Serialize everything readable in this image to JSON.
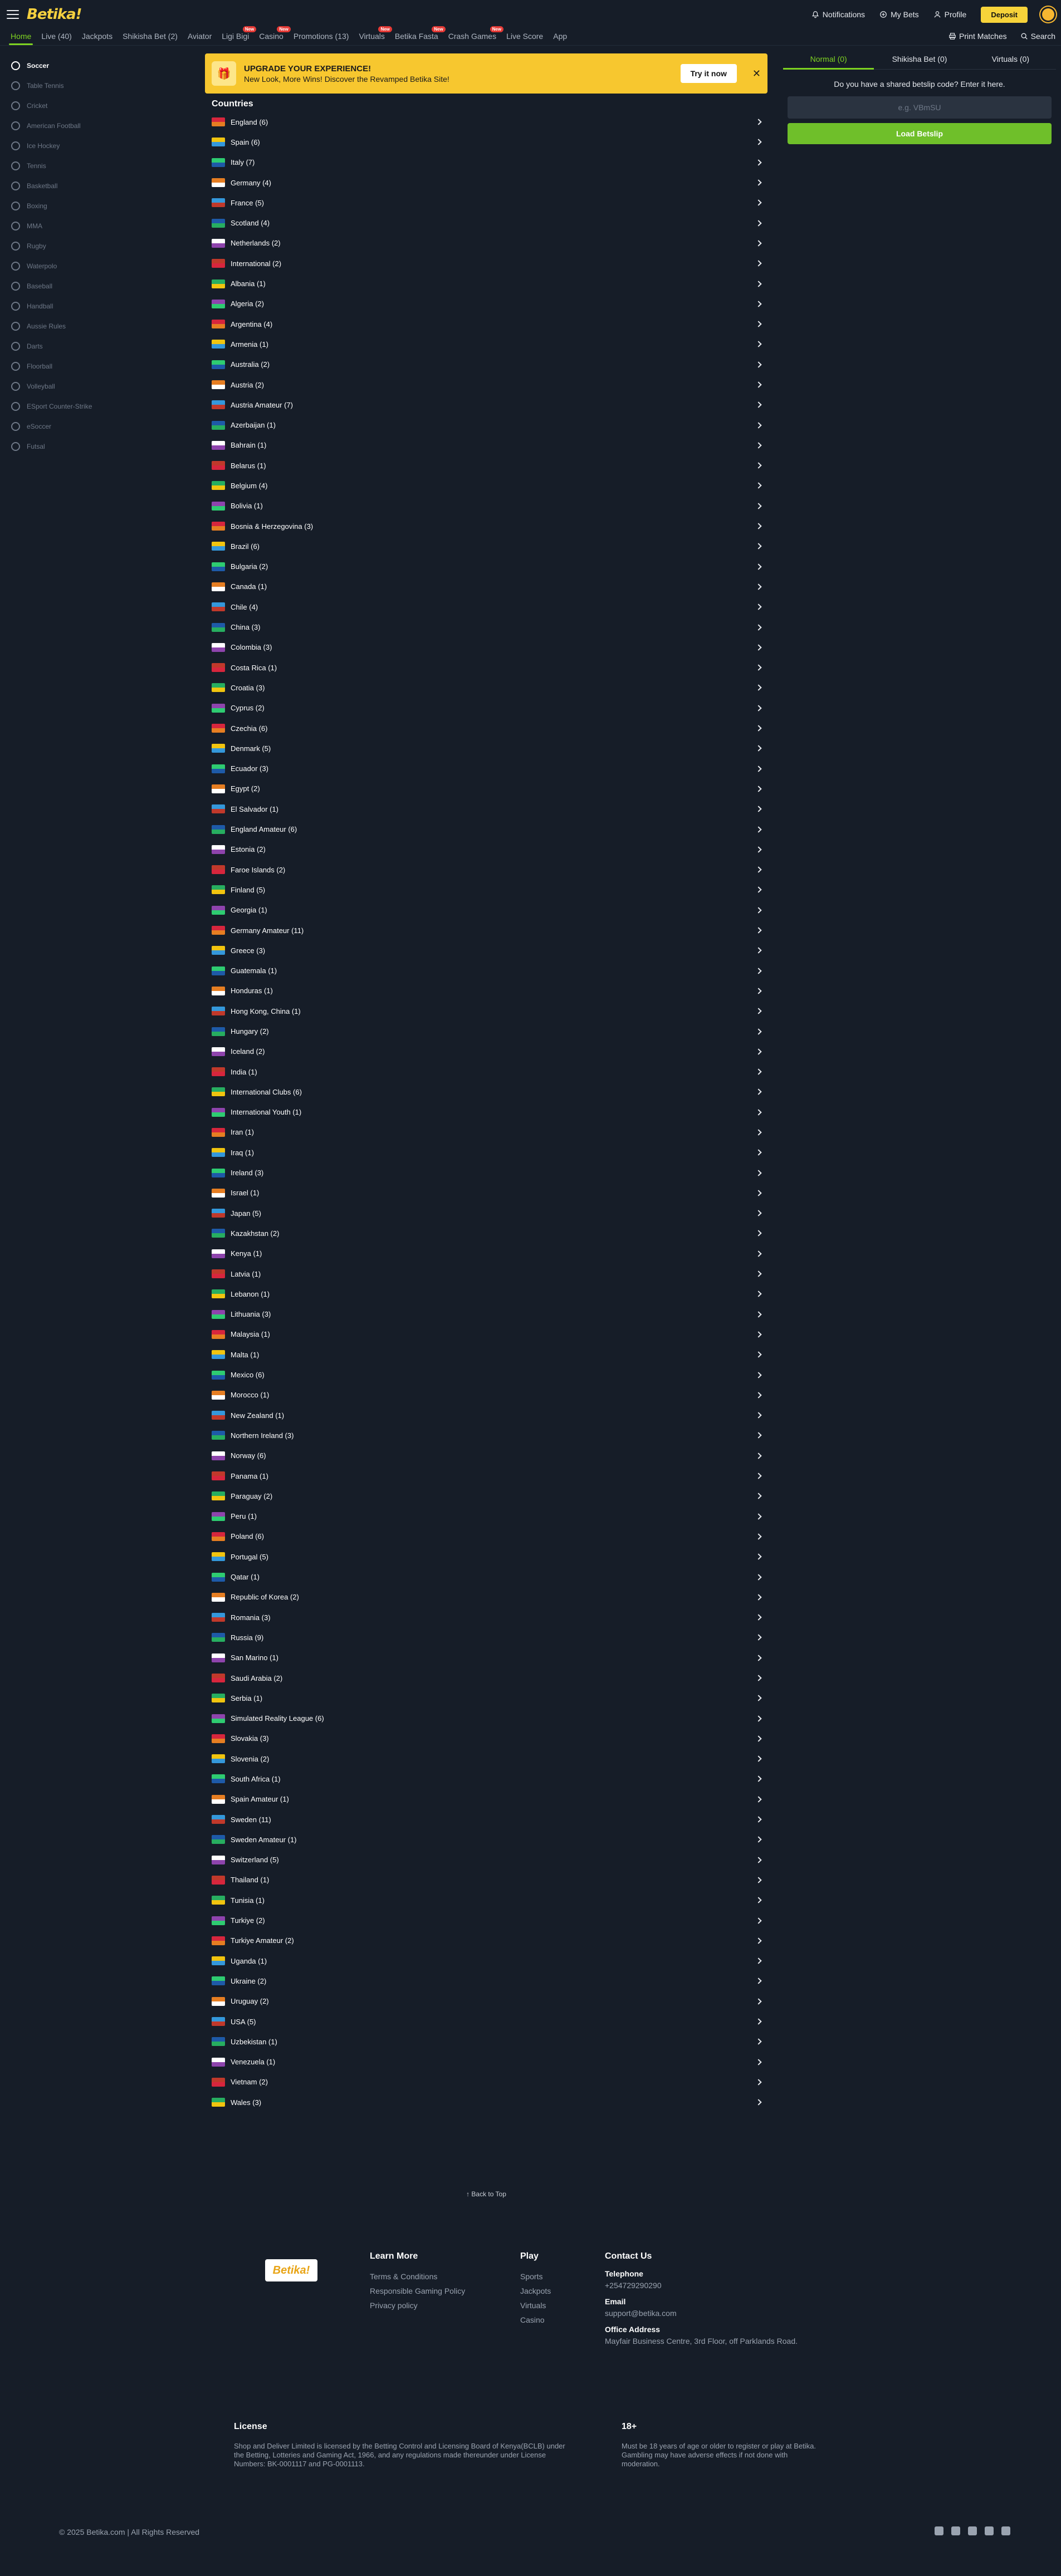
{
  "header": {
    "logo": "Betika!",
    "notifications": "Notifications",
    "my_bets": "My Bets",
    "profile": "Profile",
    "deposit": "Deposit"
  },
  "nav": {
    "items": [
      {
        "label": "Home",
        "badge": ""
      },
      {
        "label": "Live (40)",
        "badge": ""
      },
      {
        "label": "Jackpots",
        "badge": ""
      },
      {
        "label": "Shikisha Bet (2)",
        "badge": ""
      },
      {
        "label": "Aviator",
        "badge": ""
      },
      {
        "label": "Ligi Bigi",
        "badge": "New"
      },
      {
        "label": "Casino",
        "badge": "New"
      },
      {
        "label": "Promotions (13)",
        "badge": ""
      },
      {
        "label": "Virtuals",
        "badge": "New"
      },
      {
        "label": "Betika Fasta",
        "badge": "New"
      },
      {
        "label": "Crash Games",
        "badge": "New"
      },
      {
        "label": "Live Score",
        "badge": ""
      },
      {
        "label": "App",
        "badge": ""
      }
    ],
    "print_matches": "Print Matches",
    "search": "Search"
  },
  "sidebar": {
    "items": [
      "Soccer",
      "Table Tennis",
      "Cricket",
      "American Football",
      "Ice Hockey",
      "Tennis",
      "Basketball",
      "Boxing",
      "MMA",
      "Rugby",
      "Waterpolo",
      "Baseball",
      "Handball",
      "Aussie Rules",
      "Darts",
      "Floorball",
      "Volleyball",
      "ESport Counter-Strike",
      "eSoccer",
      "Futsal"
    ]
  },
  "promo": {
    "title": "UPGRADE YOUR EXPERIENCE!",
    "subtitle": "New Look, More Wins! Discover the Revamped Betika Site!",
    "button": "Try it now",
    "close": "✕"
  },
  "countries_title": "Countries",
  "countries": [
    "England (6)",
    "Spain (6)",
    "Italy (7)",
    "Germany (4)",
    "France (5)",
    "Scotland (4)",
    "Netherlands (2)",
    "International (2)",
    "Albania (1)",
    "Algeria (2)",
    "Argentina (4)",
    "Armenia (1)",
    "Australia (2)",
    "Austria (2)",
    "Austria Amateur (7)",
    "Azerbaijan (1)",
    "Bahrain (1)",
    "Belarus (1)",
    "Belgium (4)",
    "Bolivia (1)",
    "Bosnia & Herzegovina (3)",
    "Brazil (6)",
    "Bulgaria (2)",
    "Canada (1)",
    "Chile (4)",
    "China (3)",
    "Colombia (3)",
    "Costa Rica (1)",
    "Croatia (3)",
    "Cyprus (2)",
    "Czechia (6)",
    "Denmark (5)",
    "Ecuador (3)",
    "Egypt (2)",
    "El Salvador (1)",
    "England Amateur (6)",
    "Estonia (2)",
    "Faroe Islands (2)",
    "Finland (5)",
    "Georgia (1)",
    "Germany Amateur (11)",
    "Greece (3)",
    "Guatemala (1)",
    "Honduras (1)",
    "Hong Kong, China (1)",
    "Hungary (2)",
    "Iceland (2)",
    "India (1)",
    "International Clubs (6)",
    "International Youth (1)",
    "Iran (1)",
    "Iraq (1)",
    "Ireland (3)",
    "Israel (1)",
    "Japan (5)",
    "Kazakhstan (2)",
    "Kenya (1)",
    "Latvia (1)",
    "Lebanon (1)",
    "Lithuania (3)",
    "Malaysia (1)",
    "Malta (1)",
    "Mexico (6)",
    "Morocco (1)",
    "New Zealand (1)",
    "Northern Ireland (3)",
    "Norway (6)",
    "Panama (1)",
    "Paraguay (2)",
    "Peru (1)",
    "Poland (6)",
    "Portugal (5)",
    "Qatar (1)",
    "Republic of Korea (2)",
    "Romania (3)",
    "Russia (9)",
    "San Marino (1)",
    "Saudi Arabia (2)",
    "Serbia (1)",
    "Simulated Reality League (6)",
    "Slovakia (3)",
    "Slovenia (2)",
    "South Africa (1)",
    "Spain Amateur (1)",
    "Sweden (11)",
    "Sweden Amateur (1)",
    "Switzerland (5)",
    "Thailand (1)",
    "Tunisia (1)",
    "Turkiye (2)",
    "Turkiye Amateur (2)",
    "Uganda (1)",
    "Ukraine (2)",
    "Uruguay (2)",
    "USA (5)",
    "Uzbekistan (1)",
    "Venezuela (1)",
    "Vietnam (2)",
    "Wales (3)"
  ],
  "flag_colors": [
    "#d7263d",
    "#f1c40f",
    "#2ecc71",
    "#e67e22",
    "#3498db",
    "#1e5aa8",
    "#ffffff",
    "#c0392b",
    "#27ae60",
    "#8e44ad"
  ],
  "back_to_top": "Back to Top",
  "betslip": {
    "tabs": [
      "Normal (0)",
      "Shikisha Bet (0)",
      "Virtuals (0)"
    ],
    "question": "Do you have a shared betslip code? Enter it here.",
    "placeholder": "e.g. VBmSU",
    "button": "Load Betslip"
  },
  "footer": {
    "logo": "Betika!",
    "learn_more": {
      "title": "Learn More",
      "links": [
        "Terms & Conditions",
        "Responsible Gaming Policy",
        "Privacy policy"
      ]
    },
    "play": {
      "title": "Play",
      "links": [
        "Sports",
        "Jackpots",
        "Virtuals",
        "Casino"
      ]
    },
    "contact": {
      "title": "Contact Us",
      "telephone_label": "Telephone",
      "telephone": "+254729290290",
      "email_label": "Email",
      "email": "support@betika.com",
      "office_label": "Office Address",
      "office": "Mayfair Business Centre, 3rd Floor, off Parklands Road."
    },
    "license": {
      "title": "License",
      "text": "Shop and Deliver Limited is licensed by the Betting Control and Licensing Board of Kenya(BCLB) under the Betting, Lotteries and Gaming Act, 1966, and any regulations made thereunder under License Numbers: BK-0001117 and PG-0001113."
    },
    "age": {
      "title": "18+",
      "text": "Must be 18 years of age or older to register or play at Betika. Gambling may have adverse effects if not done with moderation."
    },
    "copyright": "© 2025 Betika.com | All Rights Reserved"
  },
  "colors": {
    "background": "#161d28",
    "accent_green": "#7ed321",
    "brand_yellow": "#f7d33a"
  }
}
